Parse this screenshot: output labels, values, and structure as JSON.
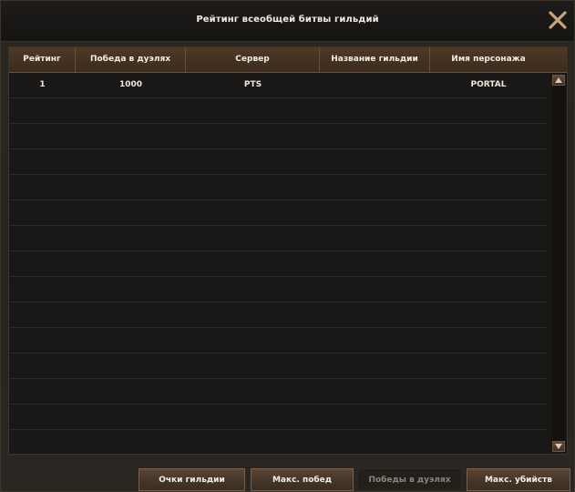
{
  "window": {
    "title": "Рейтинг всеобщей битвы гильдий"
  },
  "table": {
    "columns": [
      "Рейтинг",
      "Победа в дуэлях",
      "Сервер",
      "Название гильдии",
      "Имя персонажа"
    ],
    "rows": [
      [
        "1",
        "1000",
        "PTS",
        "",
        "PORTAL"
      ],
      [
        "",
        "",
        "",
        "",
        ""
      ],
      [
        "",
        "",
        "",
        "",
        ""
      ],
      [
        "",
        "",
        "",
        "",
        ""
      ],
      [
        "",
        "",
        "",
        "",
        ""
      ],
      [
        "",
        "",
        "",
        "",
        ""
      ],
      [
        "",
        "",
        "",
        "",
        ""
      ],
      [
        "",
        "",
        "",
        "",
        ""
      ],
      [
        "",
        "",
        "",
        "",
        ""
      ],
      [
        "",
        "",
        "",
        "",
        ""
      ],
      [
        "",
        "",
        "",
        "",
        ""
      ],
      [
        "",
        "",
        "",
        "",
        ""
      ],
      [
        "",
        "",
        "",
        "",
        ""
      ],
      [
        "",
        "",
        "",
        "",
        ""
      ],
      [
        "",
        "",
        "",
        "",
        ""
      ]
    ]
  },
  "buttons": {
    "guild_points": "Очки гильдии",
    "max_wins": "Макс. побед",
    "duel_wins": "Победы в дуэлях",
    "max_kills": "Макс. убийств"
  },
  "colors": {
    "accent": "#4e3926",
    "border": "#6a5037",
    "close_icon": "#c9a27a"
  },
  "icons": {
    "close": "close-icon",
    "scroll_up": "arrow-up-icon",
    "scroll_down": "arrow-down-icon"
  }
}
